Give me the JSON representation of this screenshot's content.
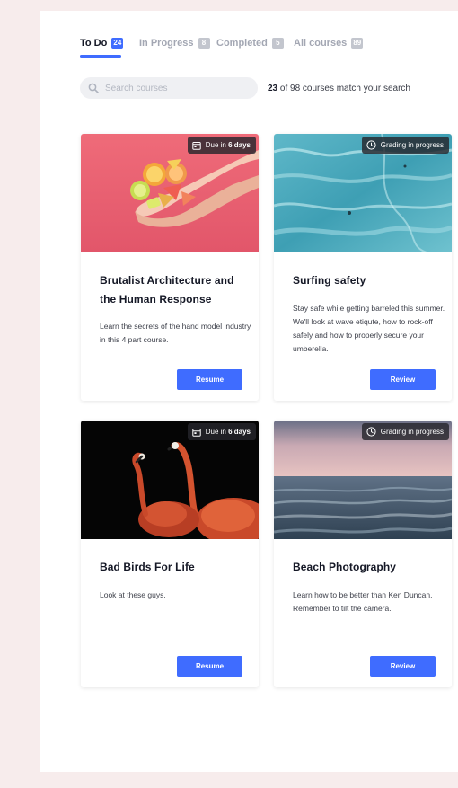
{
  "tabs": [
    {
      "label": "To Do",
      "count": "24"
    },
    {
      "label": "In Progress",
      "count": "8"
    },
    {
      "label": "Completed",
      "count": "5"
    },
    {
      "label": "All courses",
      "count": "89"
    }
  ],
  "search": {
    "placeholder": "Search courses"
  },
  "results": {
    "matched": "23",
    "rest": " of 98 courses match your search"
  },
  "courses": [
    {
      "title": "Brutalist Architecture and the Human Response",
      "description": "Learn the secrets of the hand model industry in this 4 part course.",
      "badge": {
        "icon": "calendar-icon",
        "prefix": "Due in ",
        "emphasis": "6 days"
      },
      "button": "Resume"
    },
    {
      "title": "Surfing safety",
      "description": "Stay safe while getting barreled this summer. We'll look at wave etiqute, how to rock-off safely and how to properly secure your umberella.",
      "badge": {
        "icon": "clock-icon",
        "text": "Grading in progress"
      },
      "button": "Review"
    },
    {
      "title": "Bad Birds For Life",
      "description": "Look at these guys.",
      "badge": {
        "icon": "calendar-icon",
        "prefix": "Due in ",
        "emphasis": "6 days"
      },
      "button": "Resume"
    },
    {
      "title": "Beach Photography",
      "description": "Learn how to be better than Ken Duncan. Remember to tilt the camera.",
      "badge": {
        "icon": "clock-icon",
        "text": "Grading in progress"
      },
      "button": "Review"
    }
  ],
  "colors": {
    "accent": "#3f6cff",
    "page_background": "#f7ecec"
  }
}
